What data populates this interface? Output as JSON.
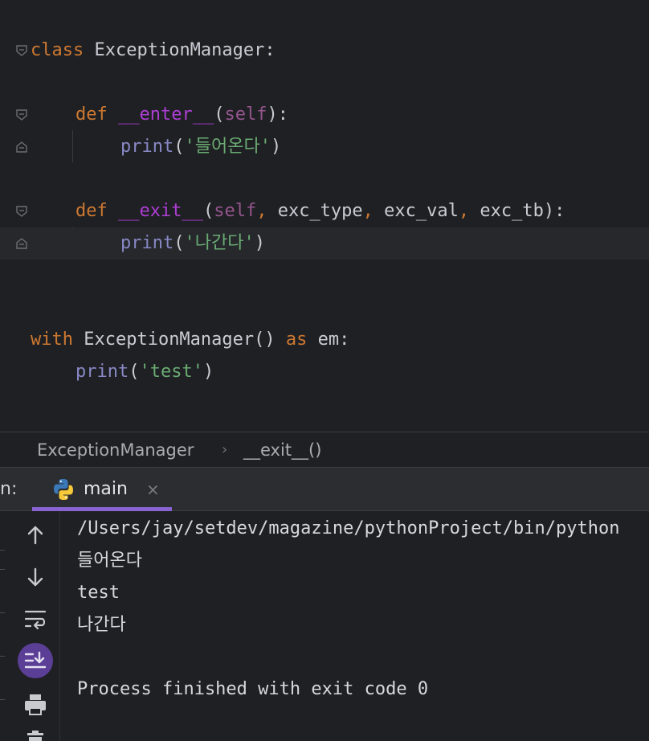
{
  "editor": {
    "lines": {
      "l1": {
        "class_kw": "class",
        "class_name": " ExceptionManager",
        "colon": ":"
      },
      "l3": {
        "def_kw": "def",
        "fn": "__enter__",
        "open": "(",
        "self": "self",
        "close": "):"
      },
      "l4": {
        "print": "print",
        "open": "(",
        "str": "'들어온다'",
        "close": ")"
      },
      "l6": {
        "def_kw": "def",
        "fn": "__exit__",
        "open": "(",
        "self": "self",
        "comma1": ",",
        "a1": " exc_type",
        "comma2": ",",
        "a2": " exc_val",
        "comma3": ",",
        "a3": " exc_tb",
        "close": "):"
      },
      "l7": {
        "print": "print",
        "open": "(",
        "str": "'나간다'",
        "close": ")"
      },
      "l10": {
        "with_kw": "with",
        "call": " ExceptionManager()",
        "as_kw": " as",
        "var": " em:"
      },
      "l11": {
        "print": "print",
        "open": "(",
        "str": "'test'",
        "close": ")"
      }
    }
  },
  "breadcrumb": {
    "class_name": "ExceptionManager",
    "method_name": "__exit__()"
  },
  "run_panel": {
    "label": "n:",
    "tab": {
      "label": "main",
      "close": "×"
    },
    "accent": "#8a63d2"
  },
  "console": {
    "lines": [
      "/Users/jay/setdev/magazine/pythonProject/bin/python",
      "들어온다",
      "test",
      "나간다",
      "",
      "Process finished with exit code 0"
    ]
  },
  "icons": [
    "fold-icon",
    "python-icon",
    "arrow-up-icon",
    "arrow-down-icon",
    "soft-wrap-icon",
    "scroll-to-end-icon",
    "print-icon",
    "trash-icon"
  ]
}
